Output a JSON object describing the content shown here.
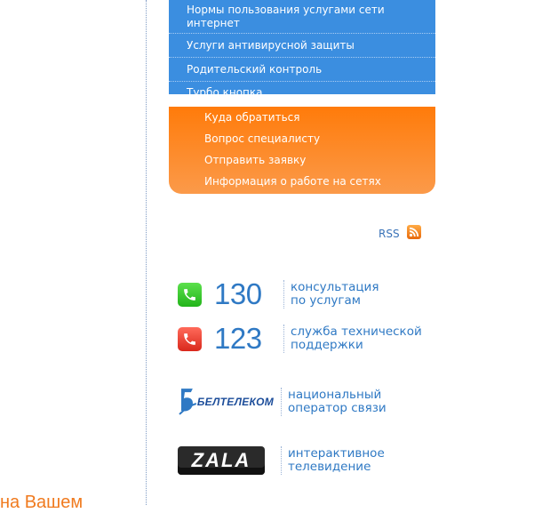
{
  "left_link": "ь на Вашем",
  "blue_menu": {
    "items": [
      {
        "label": "Нормы пользования услугами сети интернет"
      },
      {
        "label": "Услуги антивирусной защиты"
      },
      {
        "label": "Родительский контроль"
      },
      {
        "label": "Турбо кнопка"
      }
    ]
  },
  "orange_menu": {
    "items": [
      {
        "label": "Куда обратиться"
      },
      {
        "label": "Вопрос специалисту"
      },
      {
        "label": "Отправить заявку"
      },
      {
        "label": "Информация о работе на сетях"
      }
    ]
  },
  "rss": {
    "label": "RSS",
    "icon": "rss-icon"
  },
  "phones": [
    {
      "number": "130",
      "line1": "консультация",
      "line2": "по услугам",
      "icon": "phone-icon",
      "color": "#2ec425"
    },
    {
      "number": "123",
      "line1": "служба технической",
      "line2": "поддержки",
      "icon": "phone-icon",
      "color": "#e8382a"
    }
  ],
  "partners": [
    {
      "logo_text": "БЕЛТЕЛЕКОМ",
      "line1": "национальный",
      "line2": "оператор связи"
    },
    {
      "logo_text": "ZALA",
      "line1": "интерактивное",
      "line2": "телевидение"
    }
  ],
  "colors": {
    "blue_menu": "#3b8ee0",
    "orange_menu": "#ff7b0a",
    "link_blue": "#2f79c4",
    "accent_orange": "#f07a1e"
  }
}
